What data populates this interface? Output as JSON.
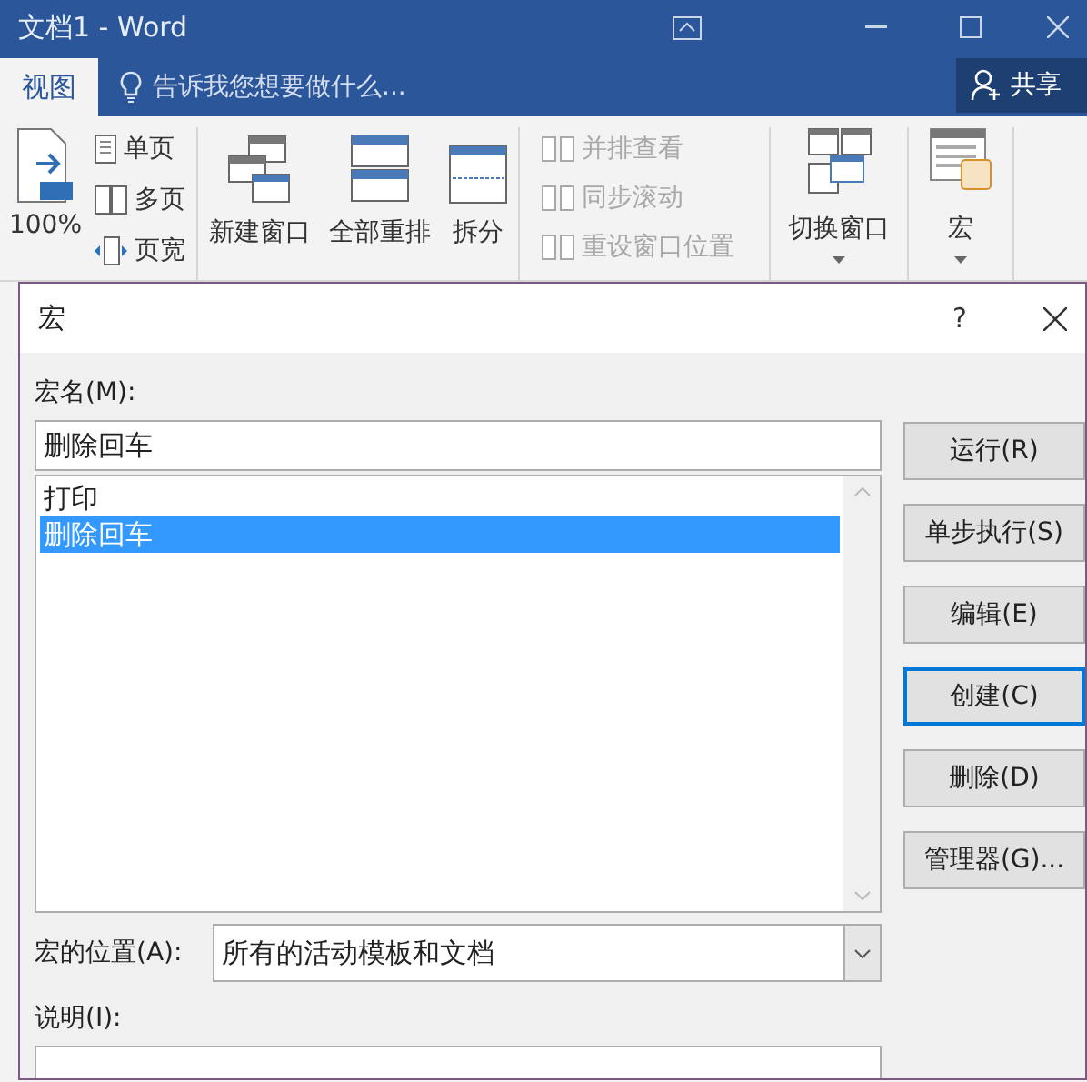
{
  "window": {
    "title": "文档1 - Word"
  },
  "ribbon_tabs": [
    {
      "label": "视图",
      "selected": true
    }
  ],
  "tell_me": {
    "placeholder": "告诉我您想要做什么..."
  },
  "share_button": {
    "label": "共享"
  },
  "ribbon": {
    "zoom": {
      "label": "100%"
    },
    "page_views": [
      {
        "label": "单页"
      },
      {
        "label": "多页"
      },
      {
        "label": "页宽"
      }
    ],
    "window_commands": [
      {
        "label": "新建窗口"
      },
      {
        "label": "全部重排"
      },
      {
        "label": "拆分"
      }
    ],
    "sync_commands": [
      {
        "label": "并排查看",
        "disabled": true
      },
      {
        "label": "同步滚动",
        "disabled": true
      },
      {
        "label": "重设窗口位置",
        "disabled": true
      }
    ],
    "switch_windows": {
      "label": "切换窗口"
    },
    "macros": {
      "label": "宏"
    }
  },
  "dialog": {
    "title": "宏",
    "help": "?",
    "name_label": "宏名(M):",
    "name_value": "删除回车",
    "macros": [
      {
        "name": "打印",
        "selected": false
      },
      {
        "name": "删除回车",
        "selected": true
      }
    ],
    "buttons": [
      {
        "label": "运行(R)",
        "focused": false
      },
      {
        "label": "单步执行(S)",
        "focused": false
      },
      {
        "label": "编辑(E)",
        "focused": false
      },
      {
        "label": "创建(C)",
        "focused": true
      },
      {
        "label": "删除(D)",
        "focused": false
      },
      {
        "label": "管理器(G)...",
        "focused": false
      }
    ],
    "location_label": "宏的位置(A):",
    "location_value": "所有的活动模板和文档",
    "description_label": "说明(I):"
  }
}
